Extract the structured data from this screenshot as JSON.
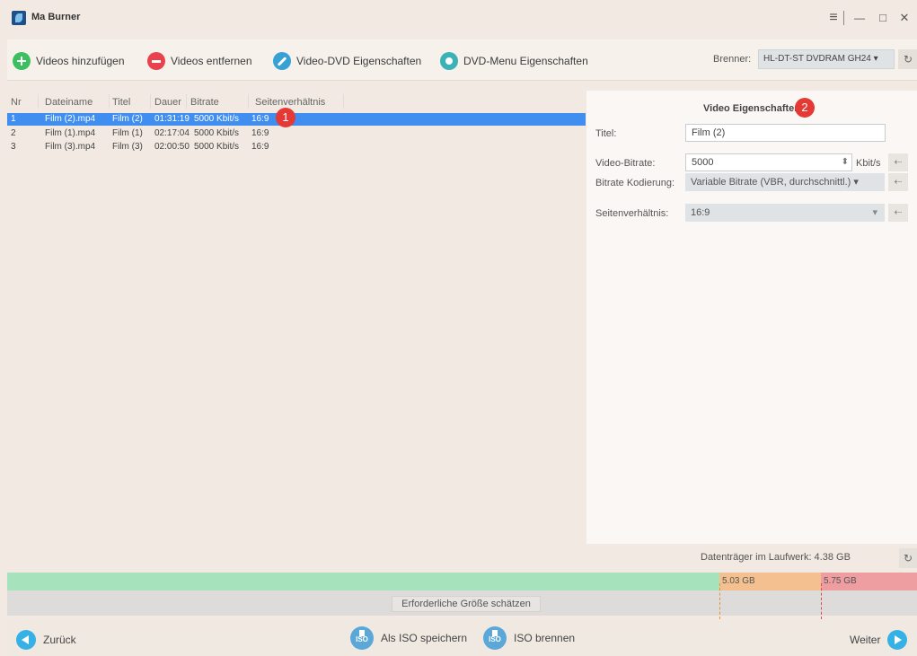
{
  "window": {
    "title": "Ma Burner",
    "menu_glyph": "≡",
    "minimize_glyph": "—",
    "maximize_glyph": "□",
    "close_glyph": "✕"
  },
  "toolbar": {
    "add_videos": "Videos hinzufügen",
    "remove_videos": "Videos entfernen",
    "dvd_properties": "Video-DVD Eigenschaften",
    "menu_properties": "DVD-Menu Eigenschaften",
    "burner_label": "Brenner:",
    "burner_value": "HL-DT-ST DVDRAM GH24 ▾",
    "refresh_glyph": "↻"
  },
  "list": {
    "headers": [
      "Nr",
      "Dateiname",
      "Titel",
      "Dauer",
      "Bitrate",
      "Seitenverhältnis"
    ],
    "rows": [
      {
        "nr": "1",
        "file": "Film (2).mp4",
        "title": "Film (2)",
        "duration": "01:31:19",
        "bitrate": "5000 Kbit/s",
        "aspect": "16:9"
      },
      {
        "nr": "2",
        "file": "Film (1).mp4",
        "title": "Film (1)",
        "duration": "02:17:04",
        "bitrate": "5000 Kbit/s",
        "aspect": "16:9"
      },
      {
        "nr": "3",
        "file": "Film (3).mp4",
        "title": "Film (3)",
        "duration": "02:00:50",
        "bitrate": "5000 Kbit/s",
        "aspect": "16:9"
      }
    ],
    "selected_index": 0
  },
  "markers": {
    "one": "1",
    "two": "2"
  },
  "props": {
    "title": "Video Eigenschaften",
    "title_label": "Titel:",
    "title_value": "Film (2)",
    "bitrate_label": "Video-Bitrate:",
    "bitrate_value": "5000",
    "bitrate_unit": "Kbit/s",
    "spin_glyph": "⬍",
    "encoding_label": "Bitrate Kodierung:",
    "encoding_value": "Variable Bitrate (VBR, durchschnittl.) ▾",
    "aspect_label": "Seitenverhältnis:",
    "aspect_value": "16:9",
    "dropdown_glyph": "▾",
    "reset_glyph": "⇠"
  },
  "disk": {
    "info": "Datenträger im Laufwerk: 4.38 GB",
    "refresh_glyph": "↻",
    "mark_1": "5.03 GB",
    "mark_2": "5.75 GB",
    "estimate_button": "Erforderliche Größe schätzen"
  },
  "nav": {
    "back": "Zurück",
    "save_iso": "Als ISO speichern",
    "burn_iso": "ISO brennen",
    "next": "Weiter",
    "iso_text": "ISO"
  },
  "colors": {
    "selected_row": "#3f8ef0",
    "marker": "#e53935",
    "bar_green": "#a6e2bc",
    "bar_orange": "#f4c08f",
    "bar_red": "#ee9da0",
    "accent": "#36b1e5"
  }
}
